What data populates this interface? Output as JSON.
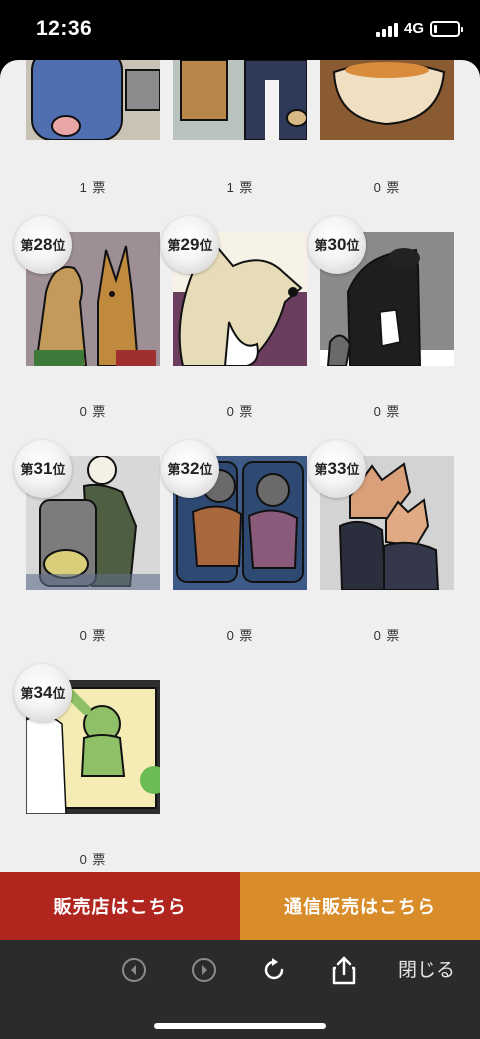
{
  "status_bar": {
    "time": "12:36",
    "network": "4G"
  },
  "ranking": {
    "vote_unit": "票",
    "partial_votes": [
      "1 票",
      "1 票",
      "0 票"
    ],
    "items": [
      {
        "rank_prefix": "第",
        "rank": "28",
        "rank_suffix": "位",
        "votes": "0 票"
      },
      {
        "rank_prefix": "第",
        "rank": "29",
        "rank_suffix": "位",
        "votes": "0 票"
      },
      {
        "rank_prefix": "第",
        "rank": "30",
        "rank_suffix": "位",
        "votes": "0 票"
      },
      {
        "rank_prefix": "第",
        "rank": "31",
        "rank_suffix": "位",
        "votes": "0 票"
      },
      {
        "rank_prefix": "第",
        "rank": "32",
        "rank_suffix": "位",
        "votes": "0 票"
      },
      {
        "rank_prefix": "第",
        "rank": "33",
        "rank_suffix": "位",
        "votes": "0 票"
      },
      {
        "rank_prefix": "第",
        "rank": "34",
        "rank_suffix": "位",
        "votes": "0 票"
      }
    ]
  },
  "buttons": {
    "store_label": "販売店はこちら",
    "mail_order_label": "通信販売はこちら"
  },
  "toolbar": {
    "close_label": "閉じる",
    "icons": [
      "back-icon",
      "forward-icon",
      "reload-icon",
      "share-icon"
    ]
  },
  "colors": {
    "store_button": "#b0261f",
    "mail_order_button": "#d98c2a",
    "toolbar_bg": "#2b2b2b",
    "sheet_bg": "#efefef"
  }
}
